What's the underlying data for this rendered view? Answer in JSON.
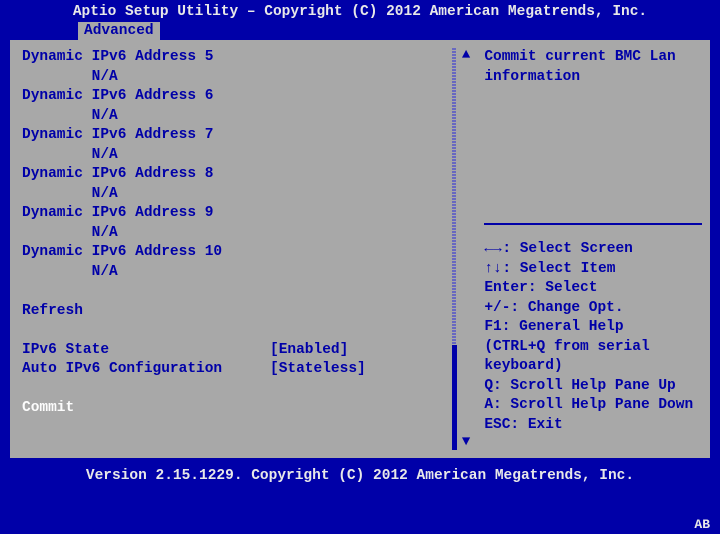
{
  "title": "Aptio Setup Utility – Copyright (C) 2012 American Megatrends, Inc.",
  "tab": "Advanced",
  "left": {
    "addrs": [
      {
        "label": "Dynamic IPv6 Address 5",
        "value": "N/A"
      },
      {
        "label": "Dynamic IPv6 Address 6",
        "value": "N/A"
      },
      {
        "label": "Dynamic IPv6 Address 7",
        "value": "N/A"
      },
      {
        "label": "Dynamic IPv6 Address 8",
        "value": "N/A"
      },
      {
        "label": "Dynamic IPv6 Address 9",
        "value": "N/A"
      },
      {
        "label": "Dynamic IPv6 Address 10",
        "value": "N/A"
      }
    ],
    "refresh": "Refresh",
    "settings": [
      {
        "label": "IPv6 State",
        "value": "[Enabled]"
      },
      {
        "label": "Auto IPv6 Configuration",
        "value": "[Stateless]"
      }
    ],
    "commit": "Commit"
  },
  "right": {
    "help1": "Commit current BMC Lan",
    "help2": "information",
    "keys": {
      "k0a": "←→",
      "k0b": ": Select Screen",
      "k1a": "↑↓",
      "k1b": ": Select Item",
      "k2": "Enter: Select",
      "k3": "+/-: Change Opt.",
      "k4": "F1: General Help",
      "k5": "(CTRL+Q from serial",
      "k6": "keyboard)",
      "k7": "Q: Scroll Help Pane Up",
      "k8": "A: Scroll Help Pane Down",
      "k9": "ESC: Exit"
    }
  },
  "footer": "Version 2.15.1229. Copyright (C) 2012 American Megatrends, Inc.",
  "corner": "AB"
}
